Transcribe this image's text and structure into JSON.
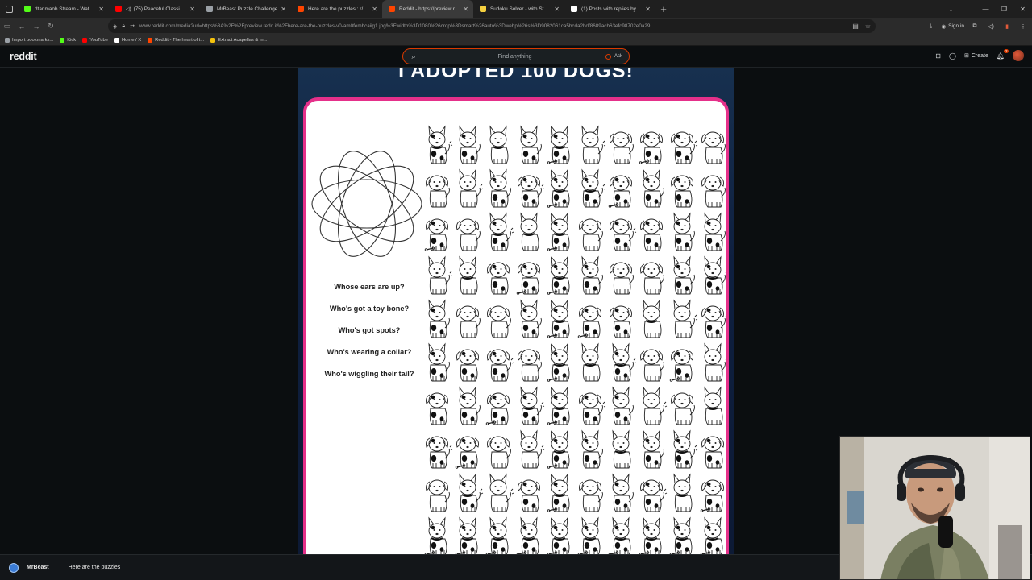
{
  "browser": {
    "tabs": [
      {
        "title": "dtanmanb Stream - Watch Live",
        "color": "#53fc18",
        "audio": false,
        "active": false
      },
      {
        "title": "(75) Peaceful Classical Musi",
        "color": "#ff0000",
        "audio": true,
        "active": false
      },
      {
        "title": "MrBeast Puzzle Challenge",
        "color": "#9aa0a6",
        "audio": false,
        "active": false
      },
      {
        "title": "Here are the puzzles : r/MrBeast",
        "color": "#ff4500",
        "audio": false,
        "active": false
      },
      {
        "title": "Reddit - https://preview.redd.it",
        "color": "#ff4500",
        "audio": false,
        "active": true
      },
      {
        "title": "Sudoku Solver - with Step by St",
        "color": "#f4d03f",
        "audio": false,
        "active": false
      },
      {
        "title": "(1) Posts with replies by MrBeas",
        "color": "#ffffff",
        "audio": false,
        "active": false
      }
    ],
    "new_tab": "+",
    "url": "www.reddit.com/media?url=https%3A%2F%2Fpreview.redd.it%2Fhere-are-the-puzzles-v0-am0fembcaiig1.jpg%3Fwidth%3D1080%26crop%3Dsmart%26auto%3Dwebp%26s%3D9082061ca5bcda2bdf8689acb63efc98702e0a29",
    "sign_in": "Sign in",
    "bookmarks": [
      {
        "label": "Import bookmarks...",
        "color": "#9aa0a6"
      },
      {
        "label": "Kick",
        "color": "#53fc18"
      },
      {
        "label": "YouTube",
        "color": "#ff0000"
      },
      {
        "label": "Home / X",
        "color": "#ffffff"
      },
      {
        "label": "Reddit - The heart of t...",
        "color": "#ff4500"
      },
      {
        "label": "Extract Acapellas & In...",
        "color": "#f4c20d"
      }
    ]
  },
  "reddit": {
    "logo": "reddit",
    "search_placeholder": "Find anything",
    "ask_label": "Ask",
    "create_label": "Create",
    "notification_count": "2"
  },
  "puzzle": {
    "headline": "I ADOPTED 100 DOGS!",
    "questions": [
      "Whose ears are up?",
      "Who's got a toy bone?",
      "Who's got spots?",
      "Who's wearing a collar?",
      "Who's wiggling their tail?"
    ],
    "grid_rows": 10,
    "grid_cols": 10
  },
  "footer": {
    "subreddit": "MrBeast",
    "post_title": "Here are the puzzles"
  },
  "colors": {
    "reddit_orange": "#d93a00",
    "card_border": "#e5308a",
    "headline_bg": "#0f2040"
  }
}
